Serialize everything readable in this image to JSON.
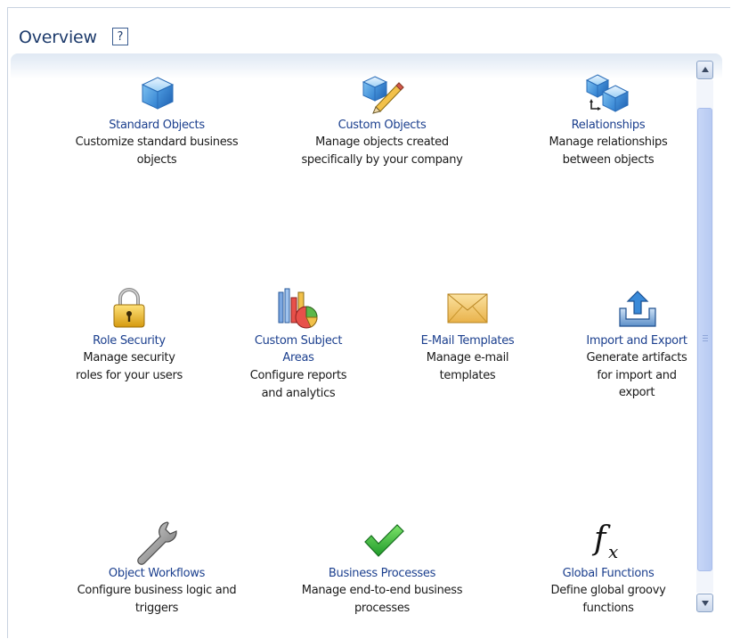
{
  "header": {
    "title": "Overview",
    "help_glyph": "?"
  },
  "items": [
    {
      "id": "standard-objects",
      "label": "Standard Objects",
      "desc": [
        "Customize standard business",
        "objects"
      ],
      "icon": "cube-icon"
    },
    {
      "id": "custom-objects",
      "label": "Custom Objects",
      "desc": [
        "Manage objects created",
        "specifically by your company"
      ],
      "icon": "cube-pencil-icon"
    },
    {
      "id": "relationships",
      "label": "Relationships",
      "desc": [
        "Manage relationships",
        "between objects"
      ],
      "icon": "linked-cubes-icon"
    },
    {
      "id": "role-security",
      "label": "Role Security",
      "desc": [
        "Manage security",
        "roles for your users"
      ],
      "icon": "padlock-icon"
    },
    {
      "id": "custom-subject-areas",
      "label": [
        "Custom Subject",
        "Areas"
      ],
      "desc": [
        "Configure reports",
        "and analytics"
      ],
      "icon": "chart-icon"
    },
    {
      "id": "email-templates",
      "label": "E-Mail Templates",
      "desc": [
        "Manage e-mail",
        "templates"
      ],
      "icon": "envelope-icon"
    },
    {
      "id": "import-export",
      "label": "Import and Export",
      "desc": [
        "Generate artifacts",
        "for import and",
        "export"
      ],
      "icon": "upload-tray-icon"
    },
    {
      "id": "object-workflows",
      "label": "Object Workflows",
      "desc": [
        "Configure business logic and",
        "triggers"
      ],
      "icon": "wrench-icon"
    },
    {
      "id": "business-processes",
      "label": "Business Processes",
      "desc": [
        "Manage end-to-end business",
        "processes"
      ],
      "icon": "checkmark-icon"
    },
    {
      "id": "global-functions",
      "label": "Global Functions",
      "desc": [
        "Define global groovy",
        "functions"
      ],
      "icon": "function-fx-icon"
    }
  ],
  "colors": {
    "link": "#1b3f8e",
    "title": "#1c3a6b",
    "text": "#1a1a1a",
    "panel": "#dfe8f3"
  }
}
